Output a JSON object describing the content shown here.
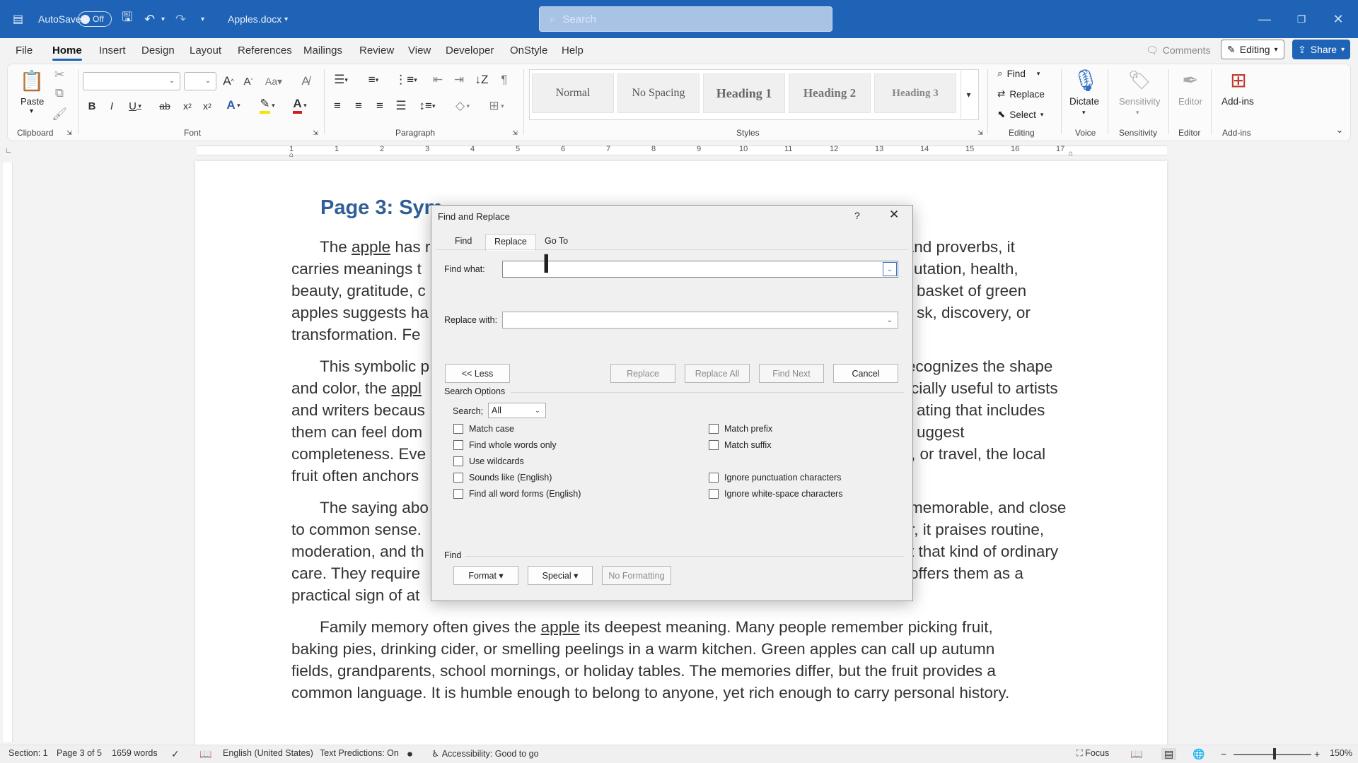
{
  "titlebar": {
    "autosave_label": "AutoSave",
    "autosave_state": "Off",
    "doc_name": "Apples.docx",
    "search_placeholder": "Search"
  },
  "menu": {
    "tabs": [
      "File",
      "Home",
      "Insert",
      "Design",
      "Layout",
      "References",
      "Mailings",
      "Review",
      "View",
      "Developer",
      "OnStyle",
      "Help"
    ],
    "active": "Home",
    "comments": "Comments",
    "editing": "Editing",
    "share": "Share"
  },
  "ribbon": {
    "groups": {
      "clipboard": "Clipboard",
      "font": "Font",
      "paragraph": "Paragraph",
      "styles": "Styles",
      "editing": "Editing",
      "voice": "Voice",
      "sensitivity": "Sensitivity",
      "editor": "Editor",
      "addins": "Add-ins"
    },
    "paste": "Paste",
    "styles": [
      "Normal",
      "No Spacing",
      "Heading 1",
      "Heading 2",
      "Heading 3"
    ],
    "find": "Find",
    "replace": "Replace",
    "select": "Select",
    "dictate": "Dictate",
    "sensitivity": "Sensitivity",
    "editor": "Editor",
    "addins": "Add-ins"
  },
  "ruler": {
    "numbers": [
      "1",
      "1",
      "2",
      "3",
      "4",
      "5",
      "6",
      "7",
      "8",
      "9",
      "10",
      "11",
      "12",
      "13",
      "14",
      "15",
      "16",
      "17"
    ]
  },
  "document": {
    "heading": "Page 3: Sym",
    "p1": {
      "a": "The ",
      "u": "apple",
      "b": " has r",
      "right": "s, and proverbs, it"
    },
    "p1_lines": [
      {
        "left": "carries meanings t",
        "right": "utation, health,"
      },
      {
        "left": "beauty, gratitude, c",
        "right": "basket of green"
      },
      {
        "left": "apples suggests ha",
        "right": "sk, discovery, or"
      },
      {
        "left": "transformation. Fe",
        "right": ""
      }
    ],
    "p2_first": {
      "left": "This symbolic p",
      "right": "ecognizes the shape"
    },
    "p2_line2": {
      "a": "and color, the ",
      "u": "appl",
      "right": "cially useful to artists"
    },
    "p2_lines": [
      {
        "left": "and writers becaus",
        "right": "ating that includes"
      },
      {
        "left": "them can feel dom",
        "right": "uggest"
      },
      {
        "left": "completeness. Eve",
        "right": ", or travel, the local"
      },
      {
        "left": "fruit often anchors",
        "right": ""
      }
    ],
    "p3_first": {
      "left": "The saying abo",
      "right": "memorable, and close"
    },
    "p3_lines": [
      {
        "left": "to common sense.",
        "right": "r, it praises routine,"
      },
      {
        "left": "moderation, and th",
        "right": "t that kind of ordinary"
      },
      {
        "left": "care. They require",
        "right": "offers them as a"
      },
      {
        "left": "practical sign of at",
        "right": ""
      }
    ],
    "p4": {
      "a": "Family memory often gives the ",
      "u": "apple",
      "b": " its deepest meaning. Many people remember picking fruit,"
    },
    "p4_lines": [
      "baking pies, drinking cider, or smelling peelings in a warm kitchen. Green apples can call up autumn",
      "fields, grandparents, school mornings, or holiday tables. The memories differ, but the fruit provides a",
      "common language. It is humble enough to belong to anyone, yet rich enough to carry personal history."
    ]
  },
  "dialog": {
    "title": "Find and Replace",
    "help": "?",
    "tabs": [
      "Find",
      "Replace",
      "Go To"
    ],
    "active_tab": "Replace",
    "find_what_label": "Find what:",
    "find_what_value": "",
    "replace_with_label": "Replace with:",
    "replace_with_value": "",
    "less_btn": "<< Less",
    "replace_btn": "Replace",
    "replace_all_btn": "Replace All",
    "find_next_btn": "Find Next",
    "cancel_btn": "Cancel",
    "search_options": "Search Options",
    "search_label": "Search;",
    "search_value": "All",
    "left_options": [
      "Match case",
      "Find whole words only",
      "Use wildcards",
      "Sounds like (English)",
      "Find all word forms (English)"
    ],
    "right_options": [
      "Match prefix",
      "Match suffix",
      "Ignore punctuation characters",
      "Ignore white-space characters"
    ],
    "find_section": "Find",
    "format_btn": "Format ▾",
    "special_btn": "Special ▾",
    "no_formatting_btn": "No Formatting"
  },
  "status": {
    "section": "Section: 1",
    "page": "Page 3 of 5",
    "words": "1659 words",
    "language": "English (United States)",
    "text_predictions": "Text Predictions: On",
    "accessibility": "Accessibility: Good to go",
    "focus": "Focus",
    "zoom": "150%"
  }
}
